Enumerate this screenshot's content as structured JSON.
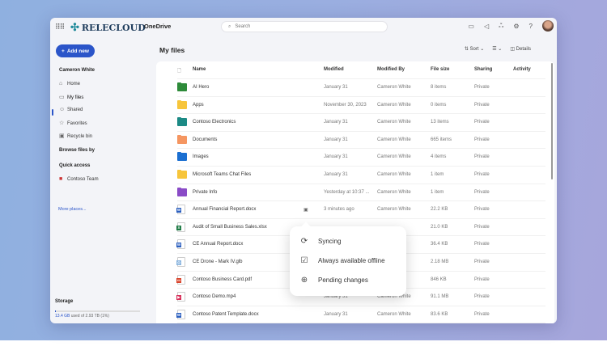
{
  "app": {
    "brand": "RELECLOUD",
    "name": "OneDrive",
    "search_placeholder": "Search"
  },
  "sidebar": {
    "add_new": "Add new",
    "user": "Cameron White",
    "items": [
      {
        "label": "Home",
        "icon": "home-icon"
      },
      {
        "label": "My files",
        "icon": "folder-icon"
      },
      {
        "label": "Shared",
        "icon": "people-icon"
      },
      {
        "label": "Favorites",
        "icon": "star-icon"
      },
      {
        "label": "Recycle bin",
        "icon": "trash-icon"
      }
    ],
    "browse": "Browse files by",
    "quick": "Quick access",
    "quick_item": "Contoso Team",
    "more": "More places...",
    "storage": {
      "title": "Storage",
      "used": "13.4 GB",
      "rest": " used of 2.93 TB (1%)",
      "fraction": 0.01
    }
  },
  "main": {
    "title": "My files",
    "sort": "Sort",
    "details": "Details",
    "columns": [
      "Name",
      "Modified",
      "Modified By",
      "File size",
      "Sharing",
      "Activity"
    ],
    "rows": [
      {
        "name": "AI Hero",
        "type": "folder",
        "color": "#2e8b3a",
        "modified": "January 31",
        "by": "Cameron White",
        "size": "8 items",
        "sharing": "Private"
      },
      {
        "name": "Apps",
        "type": "folder",
        "color": "#f7c53b",
        "modified": "November 30, 2023",
        "by": "Cameron White",
        "size": "0 items",
        "sharing": "Private"
      },
      {
        "name": "Contoso Electronics",
        "type": "folder",
        "color": "#1c8a85",
        "modified": "January 31",
        "by": "Cameron White",
        "size": "13 items",
        "sharing": "Private"
      },
      {
        "name": "Documents",
        "type": "folder",
        "color": "#f59661",
        "modified": "January 31",
        "by": "Cameron White",
        "size": "665 items",
        "sharing": "Private"
      },
      {
        "name": "Images",
        "type": "folder",
        "color": "#1b6fd1",
        "modified": "January 31",
        "by": "Cameron White",
        "size": "4 items",
        "sharing": "Private"
      },
      {
        "name": "Microsoft Teams Chat Files",
        "type": "folder",
        "color": "#f7c53b",
        "modified": "January 31",
        "by": "Cameron White",
        "size": "1 item",
        "sharing": "Private"
      },
      {
        "name": "Private Info",
        "type": "folder",
        "color": "#8a4bc7",
        "modified": "Yesterday at 10:37 ...",
        "by": "Cameron White",
        "size": "1 item",
        "sharing": "Private"
      },
      {
        "name": "Annual Financial Report.docx",
        "type": "doc",
        "color": "#2b5fbf",
        "badge": "W",
        "modified": "3 minutes ago",
        "by": "Cameron White",
        "size": "22.2 KB",
        "sharing": "Private"
      },
      {
        "name": "Audit of Small Business Sales.xlsx",
        "type": "doc",
        "color": "#1e7b45",
        "badge": "X",
        "modified": "",
        "by": "",
        "size": "21.0 KB",
        "sharing": "Private"
      },
      {
        "name": "CE Annual Report.docx",
        "type": "doc",
        "color": "#2b5fbf",
        "badge": "W",
        "modified": "",
        "by": "",
        "size": "36.4 KB",
        "sharing": "Private"
      },
      {
        "name": "CE Drone - Mark IV.glb",
        "type": "doc",
        "color": "#8fb8e0",
        "badge": "◇",
        "modified": "",
        "by": "",
        "size": "2.18 MB",
        "sharing": "Private"
      },
      {
        "name": "Contoso Business Card.pdf",
        "type": "doc",
        "color": "#d9442c",
        "badge": "▭",
        "modified": "",
        "by": "",
        "size": "846 KB",
        "sharing": "Private"
      },
      {
        "name": "Contoso Demo.mp4",
        "type": "doc",
        "color": "#d8315b",
        "badge": "▶",
        "modified": "January 31",
        "by": "Cameron White",
        "size": "91.1 MB",
        "sharing": "Private"
      },
      {
        "name": "Contoso Patent Template.docx",
        "type": "doc",
        "color": "#2b5fbf",
        "badge": "W",
        "modified": "January 31",
        "by": "Cameron White",
        "size": "83.6 KB",
        "sharing": "Private"
      }
    ]
  },
  "popup": {
    "items": [
      {
        "label": "Syncing",
        "icon": "sync-icon"
      },
      {
        "label": "Always available offline",
        "icon": "offline-device-icon"
      },
      {
        "label": "Pending changes",
        "icon": "pending-upload-icon"
      }
    ]
  }
}
